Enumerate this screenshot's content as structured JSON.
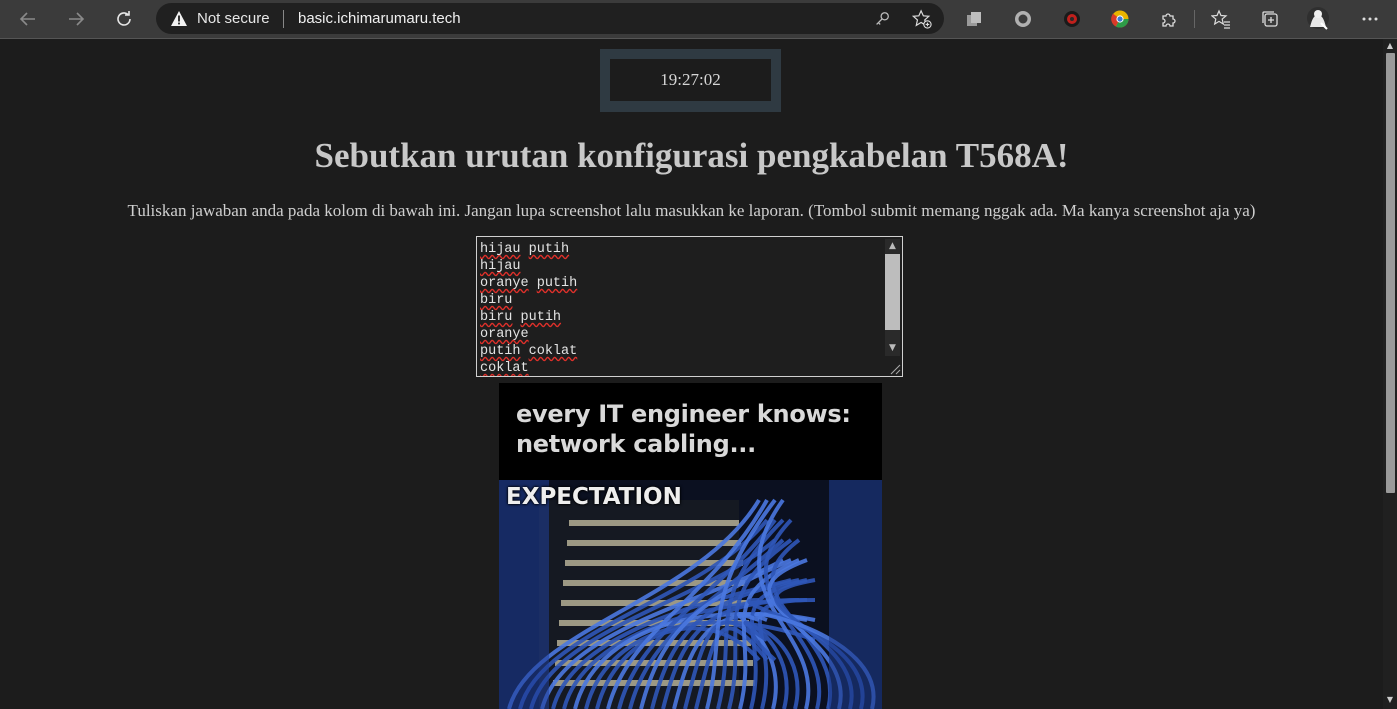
{
  "browser": {
    "security_label": "Not secure",
    "url": "basic.ichimarumaru.tech",
    "icons": [
      "back-icon",
      "forward-icon",
      "reload-icon",
      "warning-icon",
      "key-icon",
      "add-favorite-icon",
      "collections-icon",
      "extension-gray-circle-icon",
      "extension-red-circle-icon",
      "extension-chrome-icon",
      "extensions-puzzle-icon",
      "favorites-icon",
      "collections-tab-icon",
      "profile-avatar-icon",
      "more-menu-icon"
    ]
  },
  "page": {
    "clock": "19:27:02",
    "title": "Sebutkan urutan konfigurasi pengkabelan T568A!",
    "instruction": "Tuliskan jawaban anda pada kolom di bawah ini. Jangan lupa screenshot lalu masukkan ke laporan. (Tombol submit memang nggak ada. Ma kanya screenshot aja ya)",
    "answer_lines": [
      [
        "hijau",
        "putih"
      ],
      [
        "hijau"
      ],
      [
        "oranye",
        "putih"
      ],
      [
        "biru"
      ],
      [
        "biru",
        "putih"
      ],
      [
        "oranye"
      ],
      [
        "putih",
        "coklat"
      ],
      [
        "coklat"
      ]
    ],
    "meme": {
      "caption_line1": "every IT engineer knows:",
      "caption_line2": "network cabling...",
      "label": "EXPECTATION"
    }
  },
  "colors": {
    "page_bg": "#1c1c1c",
    "title_text": "#c8c8c8",
    "clock_frame": "#2f3a42",
    "spell_underline": "#e0302a",
    "cable_blue": "#2f56b8"
  }
}
